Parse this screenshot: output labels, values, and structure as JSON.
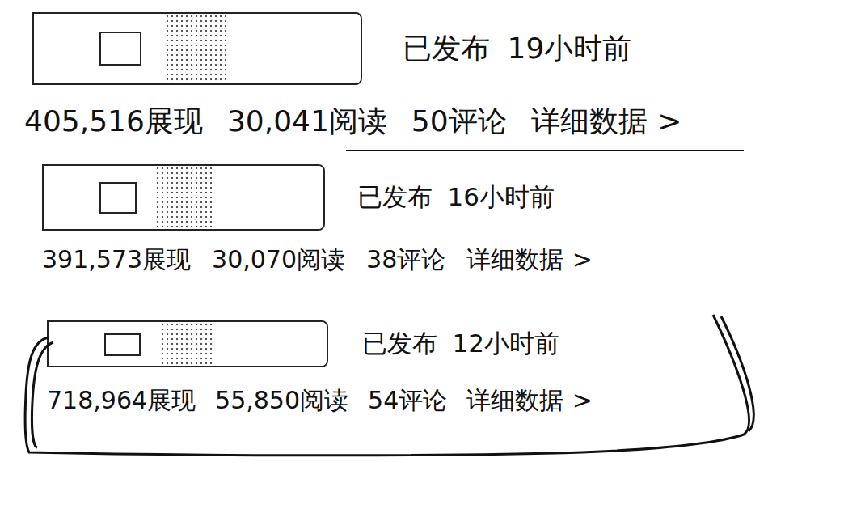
{
  "entries": [
    {
      "status": "已发布",
      "time": "19小时前",
      "impressions": "405,516展现",
      "reads": "30,041阅读",
      "comments": "50评论",
      "details": "详细数据",
      "chevron": ">",
      "annotation": "underline"
    },
    {
      "status": "已发布",
      "time": "16小时前",
      "impressions": "391,573展现",
      "reads": "30,070阅读",
      "comments": "38评论",
      "details": "详细数据",
      "chevron": ">",
      "annotation": "none"
    },
    {
      "status": "已发布",
      "time": "12小时前",
      "impressions": "718,964展现",
      "reads": "55,850阅读",
      "comments": "54评论",
      "details": "详细数据",
      "chevron": ">",
      "annotation": "circle"
    }
  ]
}
